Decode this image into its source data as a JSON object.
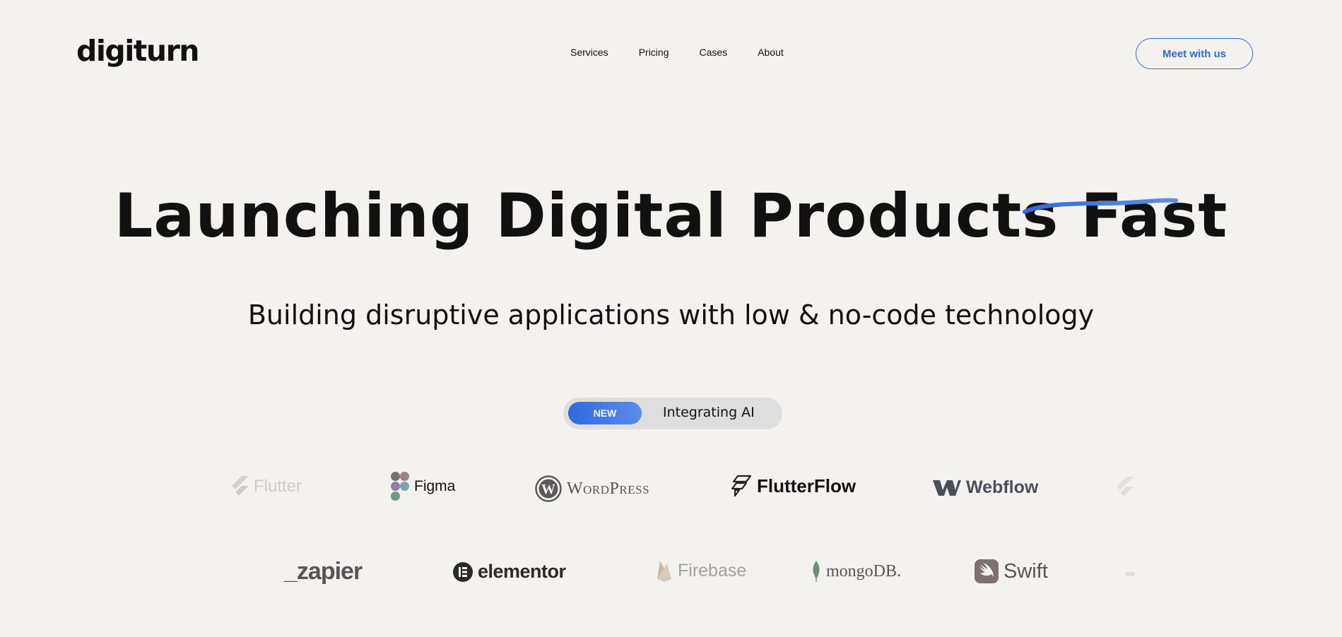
{
  "brand": {
    "name": "digiturn"
  },
  "nav": {
    "items": [
      {
        "label": "Services"
      },
      {
        "label": "Pricing"
      },
      {
        "label": "Cases"
      },
      {
        "label": "About"
      }
    ]
  },
  "cta": {
    "label": "Meet with us"
  },
  "hero": {
    "title_main": "Launching Digital Products ",
    "title_accent": "Fast",
    "subtitle": "Building disruptive applications with low & no-code technology"
  },
  "pill": {
    "badge": "NEW",
    "text": "Integrating AI"
  },
  "logos_row1": [
    {
      "name": "Flutter",
      "icon": "flutter-icon"
    },
    {
      "name": "Figma",
      "icon": "figma-icon"
    },
    {
      "name": "WordPress",
      "icon": "wordpress-icon"
    },
    {
      "name": "FlutterFlow",
      "icon": "flutterflow-icon"
    },
    {
      "name": "Webflow",
      "icon": "webflow-icon"
    }
  ],
  "logos_row2": [
    {
      "name": "_zapier",
      "icon": "zapier-icon"
    },
    {
      "name": "elementor",
      "icon": "elementor-icon"
    },
    {
      "name": "Firebase",
      "icon": "firebase-icon"
    },
    {
      "name": "mongoDB.",
      "icon": "mongodb-icon"
    },
    {
      "name": "Swift",
      "icon": "swift-icon"
    }
  ],
  "colors": {
    "accent": "#2f6be0",
    "background": "#f3f2ef",
    "text": "#111111"
  }
}
